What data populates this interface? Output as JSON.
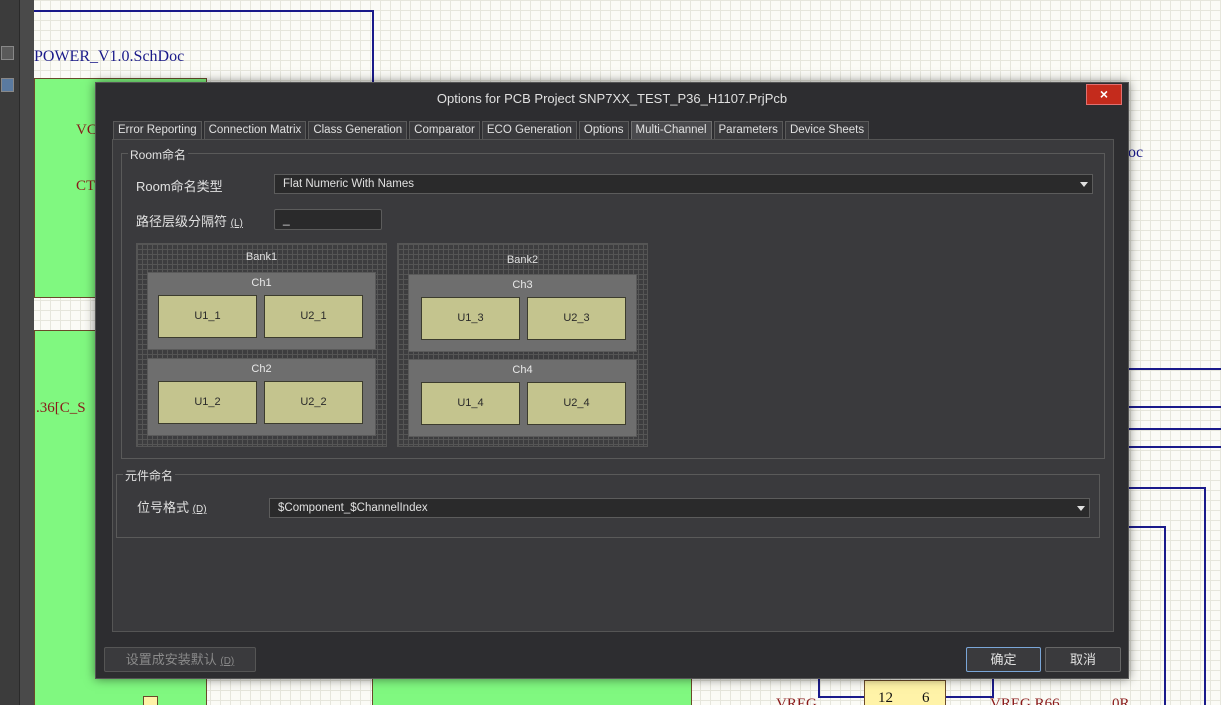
{
  "background": {
    "schematic_title": "POWER_V1.0.SchDoc",
    "sheet_text_vc": "VC",
    "sheet_text_ct": "CT",
    "sheet_text_c_s": ".36[C_S",
    "right_fragment": "oc",
    "chip_pin_left": "12",
    "chip_pin_right": "6",
    "net_left": "VREG",
    "net_right": "VREG R66",
    "net_far_right": "0R"
  },
  "dialog": {
    "title": "Options for PCB Project SNP7XX_TEST_P36_H1107.PrjPcb",
    "close": "×",
    "tabs": [
      {
        "label": "Error Reporting"
      },
      {
        "label": "Connection Matrix"
      },
      {
        "label": "Class Generation"
      },
      {
        "label": "Comparator"
      },
      {
        "label": "ECO Generation"
      },
      {
        "label": "Options"
      },
      {
        "label": "Multi-Channel",
        "active": true
      },
      {
        "label": "Parameters"
      },
      {
        "label": "Device Sheets"
      }
    ],
    "room_group": {
      "legend": "Room命名",
      "type_label": "Room命名类型",
      "type_value": "Flat Numeric With Names",
      "separator_label": "路径层级分隔符",
      "separator_hotkey": "(L)",
      "separator_value": "_"
    },
    "preview": {
      "banks": [
        {
          "label": "Bank1",
          "channels": [
            {
              "label": "Ch1",
              "components": [
                "U1_1",
                "U2_1"
              ]
            },
            {
              "label": "Ch2",
              "components": [
                "U1_2",
                "U2_2"
              ]
            }
          ]
        },
        {
          "label": "Bank2",
          "channels": [
            {
              "label": "Ch3",
              "components": [
                "U1_3",
                "U2_3"
              ]
            },
            {
              "label": "Ch4",
              "components": [
                "U1_4",
                "U2_4"
              ]
            }
          ]
        }
      ]
    },
    "component_group": {
      "legend": "元件命名",
      "format_label": "位号格式",
      "format_hotkey": "(D)",
      "format_value": "$Component_$ChannelIndex"
    },
    "buttons": {
      "set_default": "设置成安装默认",
      "set_default_hotkey": "(D)",
      "ok": "确定",
      "cancel": "取消"
    }
  },
  "colors": {
    "dialog_bg": "#2d2d30",
    "close_button": "#c42b1c",
    "component_fill": "#c4c48e",
    "sheet_green": "#80f880",
    "wire_blue": "#1a1a8a"
  }
}
